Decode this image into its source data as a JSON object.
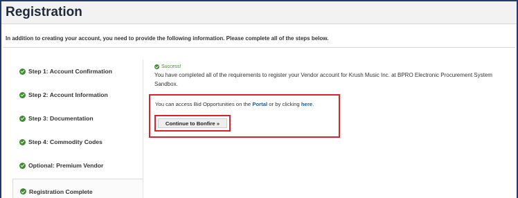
{
  "header": {
    "title": "Registration"
  },
  "intro": "In addition to creating your account, you need to provide the following information. Please complete all of the steps below.",
  "steps": [
    {
      "label": "Step 1: Account Confirmation"
    },
    {
      "label": "Step 2: Account Information"
    },
    {
      "label": "Step 3: Documentation"
    },
    {
      "label": "Step 4: Commodity Codes"
    },
    {
      "label": "Optional: Premium Vendor"
    },
    {
      "label": "Registration Complete"
    }
  ],
  "success": {
    "heading": "Success!",
    "message": "You have completed all of the requirements to register your Vendor account for Krush Music Inc. at BPRO Electronic Procurement System Sandbox."
  },
  "access": {
    "prefix": "You can access Bid Opportunities on the ",
    "portal_link": "Portal",
    "middle": " or by clicking ",
    "here_link": "here",
    "suffix": "."
  },
  "continue_button": "Continue to Bonfire »",
  "colors": {
    "success": "#3f8c2e",
    "link": "#1a5aa6",
    "highlight": "#d9212f",
    "frame": "#1f3a6b"
  }
}
